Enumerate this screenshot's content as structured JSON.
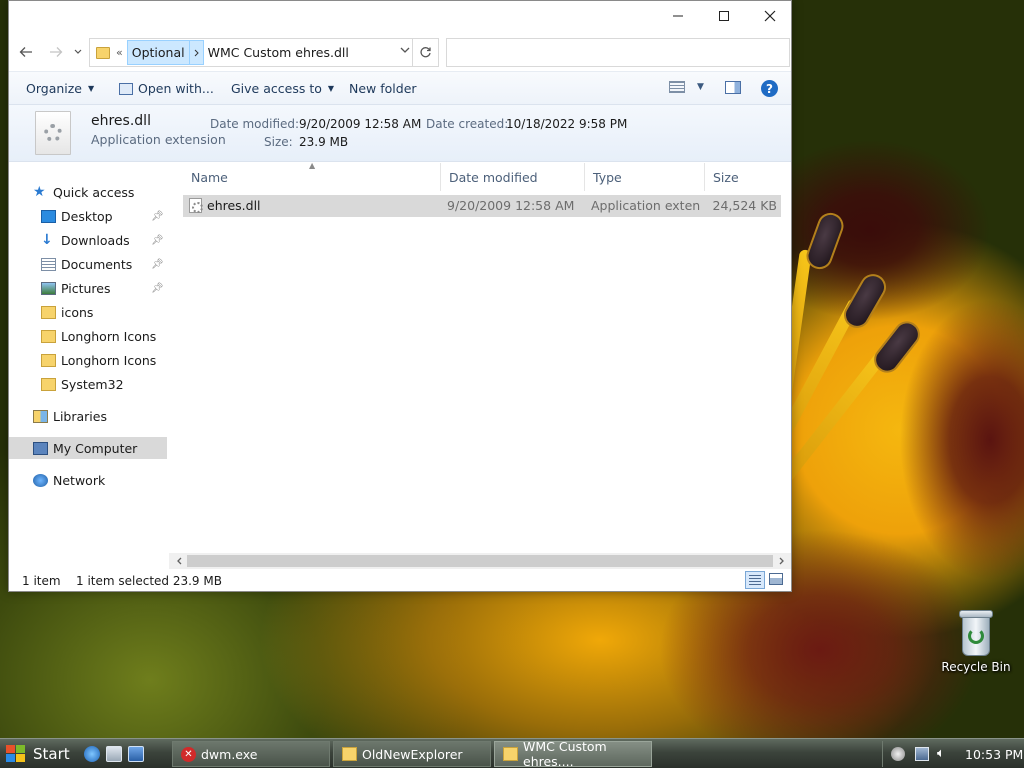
{
  "window": {
    "address": {
      "crumb_parent": "Optional",
      "crumb_current": "WMC Custom ehres.dll",
      "overflow_glyph": "«",
      "search_placeholder": ""
    },
    "toolbar": {
      "organize": "Organize",
      "open_with": "Open with...",
      "give_access": "Give access to",
      "new_folder": "New folder"
    },
    "details_pane": {
      "name": "ehres.dll",
      "type": "Application extension",
      "date_modified_label": "Date modified:",
      "date_modified": "9/20/2009 12:58 AM",
      "date_created_label": "Date created:",
      "date_created": "10/18/2022 9:58 PM",
      "size_label": "Size:",
      "size": "23.9 MB"
    },
    "nav_pane": {
      "quick_access": "Quick access",
      "items": [
        {
          "label": "Desktop",
          "icon": "desktop-icon",
          "pinned": true
        },
        {
          "label": "Downloads",
          "icon": "downloads-icon",
          "pinned": true
        },
        {
          "label": "Documents",
          "icon": "documents-icon",
          "pinned": true
        },
        {
          "label": "Pictures",
          "icon": "pictures-icon",
          "pinned": true
        },
        {
          "label": "icons",
          "icon": "folder-icon",
          "pinned": false
        },
        {
          "label": "Longhorn Icons",
          "icon": "folder-icon",
          "pinned": false
        },
        {
          "label": "Longhorn Icons",
          "icon": "folder-icon",
          "pinned": false
        },
        {
          "label": "System32",
          "icon": "folder-icon",
          "pinned": false
        }
      ],
      "libraries": "Libraries",
      "my_computer": "My Computer",
      "network": "Network"
    },
    "file_list": {
      "columns": [
        "Name",
        "Date modified",
        "Type",
        "Size"
      ],
      "rows": [
        {
          "name": "ehres.dll",
          "date_modified": "9/20/2009 12:58 AM",
          "type": "Application exten...",
          "size": "24,524 KB",
          "selected": true
        }
      ]
    },
    "status": {
      "item_count": "1 item",
      "selection": "1 item selected  23.9 MB"
    }
  },
  "desktop": {
    "recycle_bin": "Recycle Bin"
  },
  "taskbar": {
    "start": "Start",
    "tasks": [
      {
        "label": "dwm.exe",
        "icon": "error-icon"
      },
      {
        "label": "OldNewExplorer",
        "icon": "folder-icon"
      },
      {
        "label": "WMC Custom ehres....",
        "icon": "folder-icon"
      }
    ],
    "clock": "10:53 PM"
  },
  "colors": {
    "selection": "#cce8ff",
    "selected_row": "#d9d9d9",
    "toolbar_text": "#1e395b",
    "help_blue": "#1f6bc4"
  }
}
